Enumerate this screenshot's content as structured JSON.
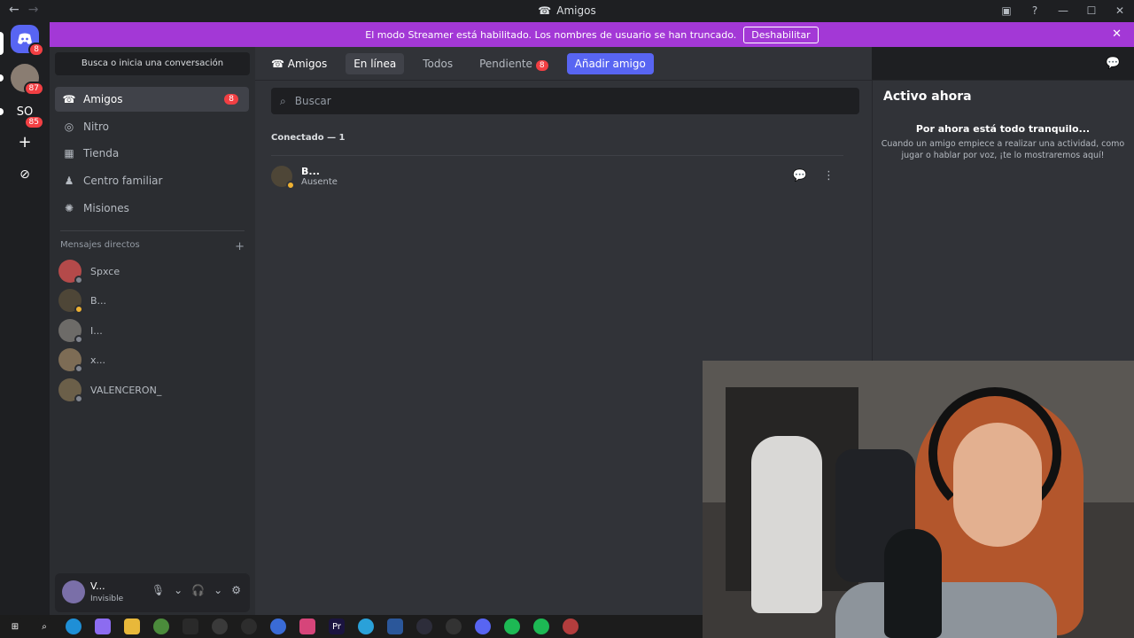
{
  "window": {
    "title": "Amigos",
    "back": "←",
    "forward": "→",
    "controls": [
      "▣",
      "?",
      "—",
      "☐",
      "✕"
    ]
  },
  "banner": {
    "text": "El modo Streamer está habilitado. Los nombres de usuario se han truncado.",
    "button": "Deshabilitar",
    "close": "✕"
  },
  "guilds": [
    {
      "name": "discord-home",
      "badge": "8",
      "color": "#5865f2"
    },
    {
      "name": "server-1",
      "badge": "87",
      "color": "#8a7d72"
    },
    {
      "name": "server-so",
      "label": "SO",
      "badge": "85",
      "color": "#1e1f22"
    },
    {
      "name": "add-server",
      "label": "+",
      "color": "#1e1f22"
    },
    {
      "name": "explore",
      "label": "⊘",
      "color": "#1e1f22"
    }
  ],
  "sidebar": {
    "search_placeholder": "Busca o inicia una conversación",
    "nav": [
      {
        "label": "Amigos",
        "icon": "friends-icon",
        "count": "8",
        "active": true
      },
      {
        "label": "Nitro",
        "icon": "nitro-icon"
      },
      {
        "label": "Tienda",
        "icon": "shop-icon"
      },
      {
        "label": "Centro familiar",
        "icon": "family-icon"
      },
      {
        "label": "Misiones",
        "icon": "quests-icon"
      }
    ],
    "dm_header": "Mensajes directos",
    "dm_add": "+",
    "dms": [
      {
        "name": "Spxce",
        "status": "offline",
        "color": "#b44a4a"
      },
      {
        "name": "B...",
        "status": "away",
        "color": "#4e4637"
      },
      {
        "name": "I...",
        "status": "offline",
        "color": "#6d6b68"
      },
      {
        "name": "x...",
        "status": "offline",
        "color": "#7d6c55"
      },
      {
        "name": "VALENCERON_",
        "status": "offline",
        "color": "#6b5f49"
      }
    ]
  },
  "user": {
    "name": "V...",
    "status": "Invisible"
  },
  "topbar": {
    "title": "Amigos",
    "tabs": [
      {
        "label": "En línea",
        "active": true
      },
      {
        "label": "Todos"
      },
      {
        "label": "Pendiente",
        "count": "8"
      }
    ],
    "add_friend": "Añadir amigo"
  },
  "main": {
    "search_placeholder": "Buscar",
    "section": "Conectado — 1",
    "friends": [
      {
        "name": "B...",
        "status": "Ausente"
      }
    ]
  },
  "active_now": {
    "title": "Activo ahora",
    "empty_title": "Por ahora está todo tranquilo...",
    "empty_text": "Cuando un amigo empiece a realizar una actividad, como jugar o hablar por voz, ¡te lo mostraremos aquí!"
  },
  "taskbar": [
    {
      "name": "start-icon",
      "color": "#1c1c1c"
    },
    {
      "name": "search-icon",
      "color": "#1c1c1c"
    },
    {
      "name": "edge-icon",
      "color": "#1f8fd6"
    },
    {
      "name": "copilot-icon",
      "color": "#8c6cf0"
    },
    {
      "name": "explorer-icon",
      "color": "#e8b83a"
    },
    {
      "name": "chrome-icon",
      "color": "#4b8b3b"
    },
    {
      "name": "store-icon",
      "color": "#2a2a2a"
    },
    {
      "name": "obs-icon",
      "color": "#3a3a3a"
    },
    {
      "name": "app-green-icon",
      "color": "#2d2d2d"
    },
    {
      "name": "app-c-icon",
      "color": "#3a6bd6"
    },
    {
      "name": "app-gradient-icon",
      "color": "#d6457a"
    },
    {
      "name": "premiere-icon",
      "color": "#1b1440"
    },
    {
      "name": "telegram-icon",
      "color": "#2aa1d9"
    },
    {
      "name": "word-icon",
      "color": "#2b579a"
    },
    {
      "name": "app-ring-icon",
      "color": "#2d2d3a"
    },
    {
      "name": "app-circle-icon",
      "color": "#333"
    },
    {
      "name": "discord-icon",
      "color": "#5865f2"
    },
    {
      "name": "spotify-icon",
      "color": "#1db954"
    },
    {
      "name": "spotify2-icon",
      "color": "#1db954"
    },
    {
      "name": "chrome2-icon",
      "color": "#b33d3d"
    }
  ]
}
